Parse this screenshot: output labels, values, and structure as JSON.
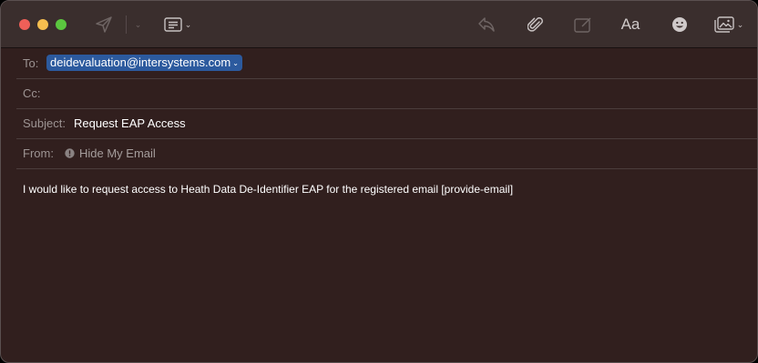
{
  "window": {
    "controls": [
      "close",
      "minimize",
      "zoom"
    ]
  },
  "toolbar": {
    "send_icon": "paper-plane-icon",
    "header_fields_icon": "header-fields-icon",
    "reply_icon": "reply-icon",
    "attach_icon": "paperclip-icon",
    "markup_icon": "markup-icon",
    "format_label": "Aa",
    "emoji_icon": "emoji-icon",
    "photo_icon": "photo-browser-icon"
  },
  "headers": {
    "to": {
      "label": "To:",
      "recipient": "deidevaluation@intersystems.com"
    },
    "cc": {
      "label": "Cc:",
      "value": ""
    },
    "subject": {
      "label": "Subject:",
      "value": "Request EAP Access"
    },
    "from": {
      "label": "From:",
      "value": "Hide My Email"
    }
  },
  "body": {
    "text": "I would like to request access to Heath Data De-Identifier EAP for the registered email [provide-email]"
  },
  "colors": {
    "window_bg": "#311f1e",
    "toolbar_bg": "#3a2e2d",
    "recipient_chip": "#2c5a9e",
    "close": "#ee5f58",
    "minimize": "#f5be4f",
    "zoom": "#5bc73f"
  }
}
